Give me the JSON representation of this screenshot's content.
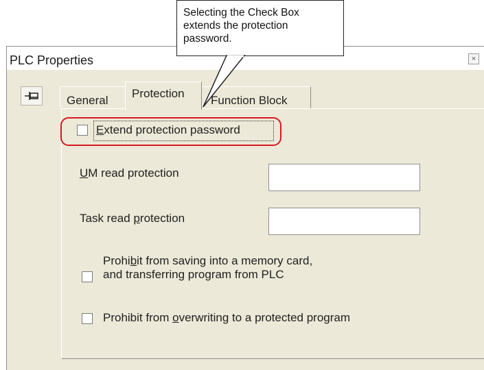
{
  "callout": {
    "text_line1": "Selecting the Check Box",
    "text_line2": "extends the protection",
    "text_line3": "password."
  },
  "window": {
    "title": "PLC Properties",
    "close_glyph": "×"
  },
  "toolbar": {
    "pin_icon": "pin-icon"
  },
  "tabs": [
    {
      "label": "General",
      "selected": false
    },
    {
      "label": "Protection",
      "selected": true
    },
    {
      "label": "Function Block",
      "selected": false
    }
  ],
  "protection": {
    "extend_password": {
      "checked": false,
      "label_hot": "E",
      "label_rest": "xtend protection password"
    },
    "um_read": {
      "label_hot": "U",
      "label_rest": "M read protection",
      "value": ""
    },
    "task_read": {
      "label_pre": "Task read ",
      "label_hot": "p",
      "label_rest": "rotection",
      "value": ""
    },
    "prohibit_saving": {
      "checked": false,
      "line1_pre": "Prohi",
      "line1_hot": "b",
      "line1_rest": "it from saving into a memory card,",
      "line2": "and transferring program from PLC"
    },
    "prohibit_overwrite": {
      "checked": false,
      "label_pre": "Prohibit from ",
      "label_hot": "o",
      "label_rest": "verwriting to a protected program"
    }
  },
  "colors": {
    "highlight": "#d71920",
    "dialog_bg": "#ece9d8"
  }
}
